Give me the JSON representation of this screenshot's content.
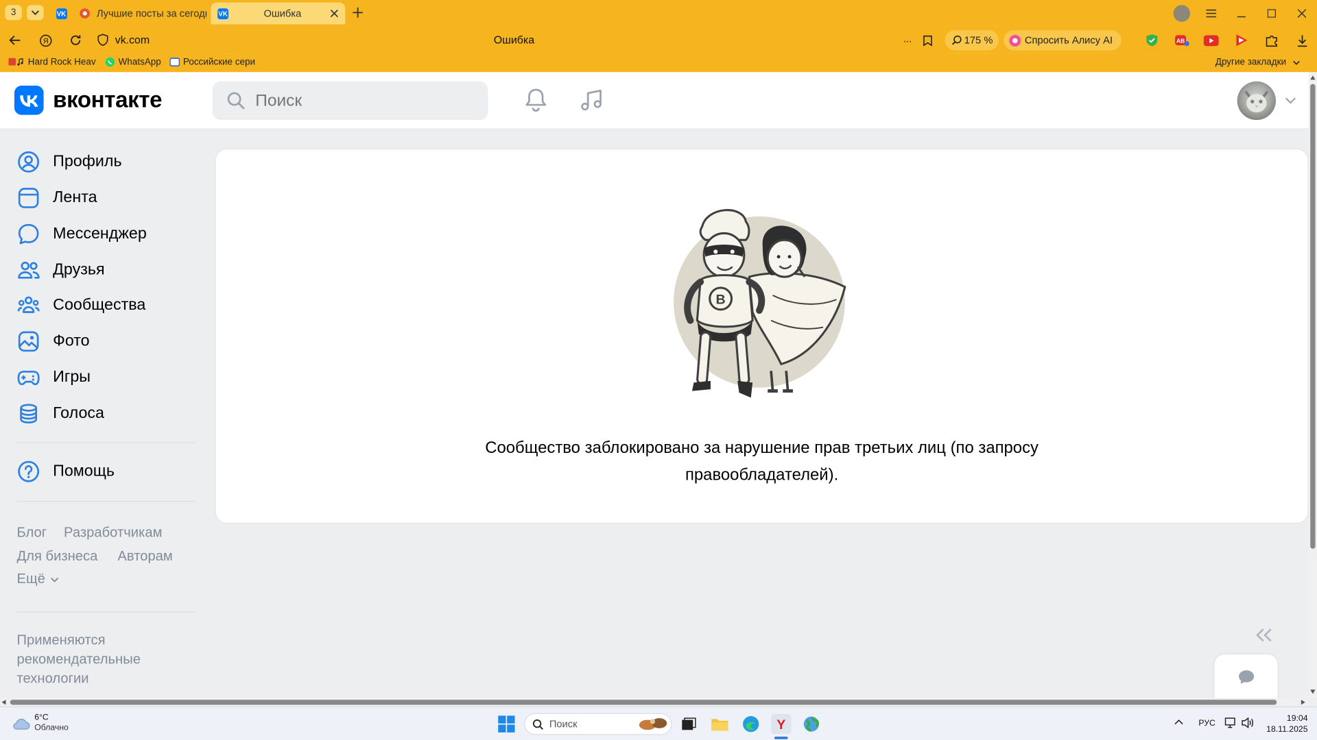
{
  "browser": {
    "tab_counter": "3",
    "tabs": [
      {
        "label": "Лучшие посты за сегодня"
      },
      {
        "label": "Ошибка",
        "active": true
      }
    ],
    "address": "vk.com",
    "page_title": "Ошибка",
    "zoom": "175 %",
    "alice_label": "Спросить Алису AI",
    "bookmarks": [
      {
        "label": "Hard Rock Heav"
      },
      {
        "label": "WhatsApp"
      },
      {
        "label": "Российские сери"
      }
    ],
    "other_bookmarks": "Другие закладки"
  },
  "vk": {
    "logo_text": "вконтакте",
    "search_placeholder": "Поиск",
    "nav": [
      {
        "label": "Профиль",
        "icon": "profile-icon"
      },
      {
        "label": "Лента",
        "icon": "feed-icon"
      },
      {
        "label": "Мессенджер",
        "icon": "messenger-icon"
      },
      {
        "label": "Друзья",
        "icon": "friends-icon"
      },
      {
        "label": "Сообщества",
        "icon": "communities-icon"
      },
      {
        "label": "Фото",
        "icon": "photo-icon"
      },
      {
        "label": "Игры",
        "icon": "games-icon"
      },
      {
        "label": "Голоса",
        "icon": "votes-icon"
      }
    ],
    "help": "Помощь",
    "footer": {
      "blog": "Блог",
      "developers": "Разработчикам",
      "business": "Для бизнеса",
      "authors": "Авторам",
      "more": "Ещё"
    },
    "recommend": [
      "Применяются",
      "рекомендательные",
      "технологии"
    ],
    "error_message_line1": "Сообщество заблокировано за нарушение прав третьих лиц (по запросу",
    "error_message_line2": "правообладателей)."
  },
  "taskbar": {
    "temp": "6°C",
    "weather": "Облачно",
    "search_placeholder": "Поиск",
    "lang": "РУС",
    "time": "19:04",
    "date": "18.11.2025"
  },
  "colors": {
    "browser_accent": "#f6b51e",
    "vk_blue": "#0077ff",
    "nav_icon": "#2d81e0"
  }
}
